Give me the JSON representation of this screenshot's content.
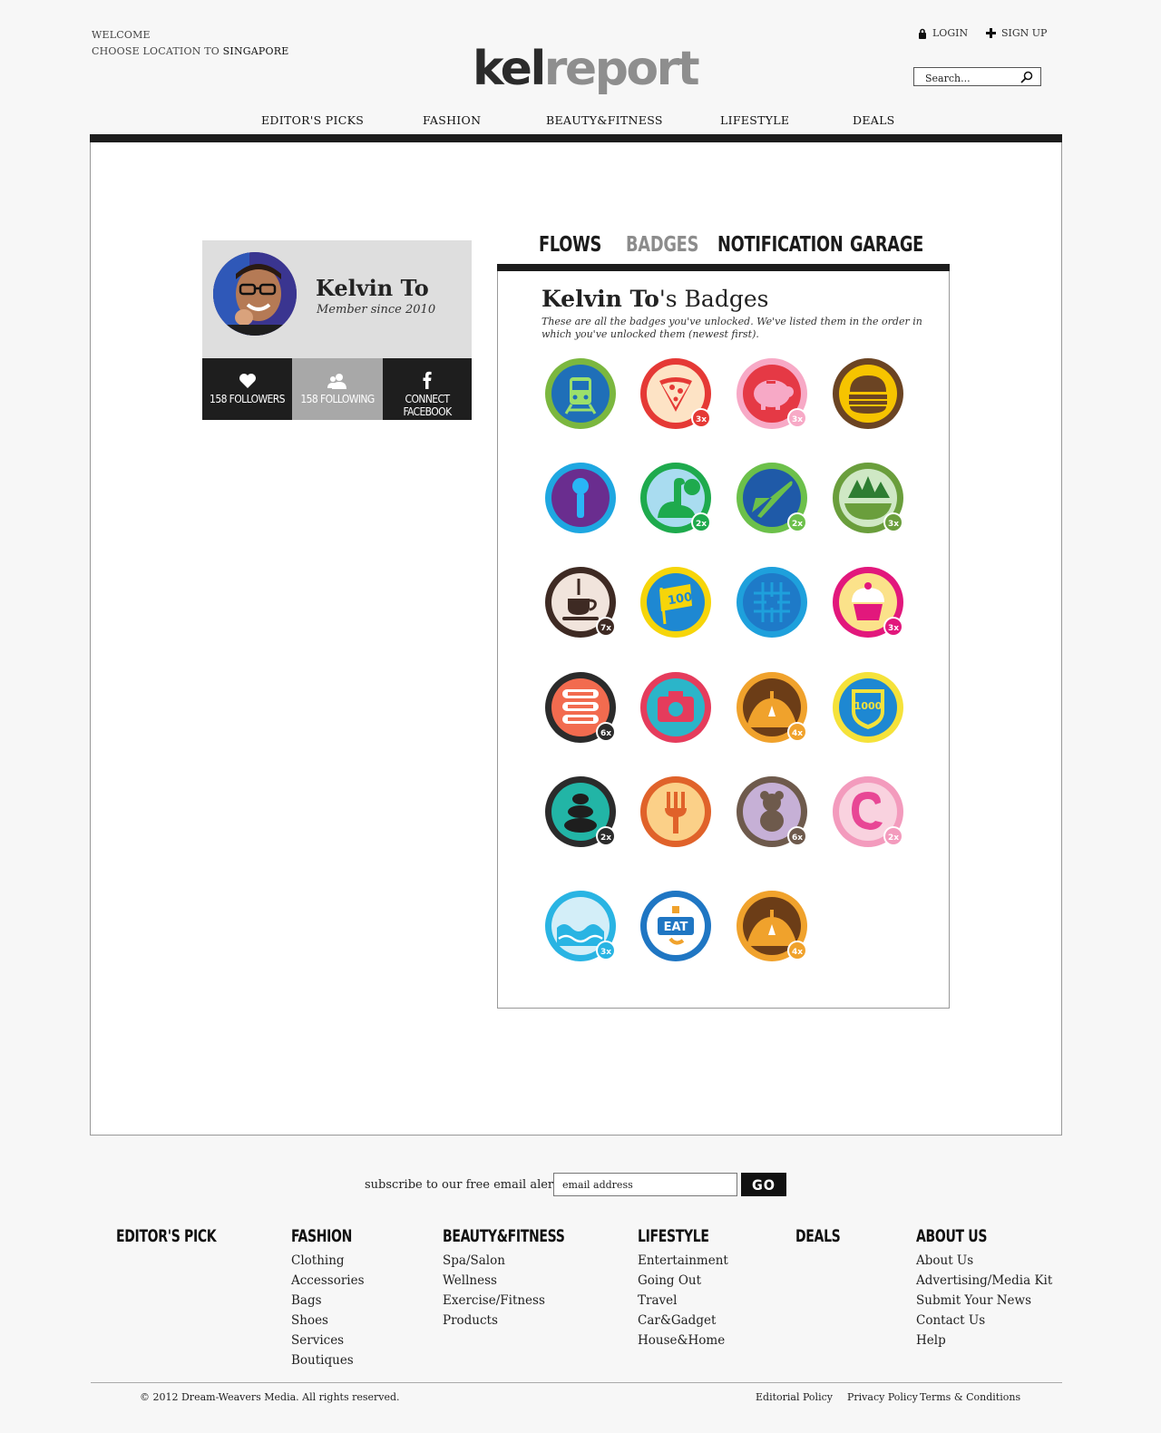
{
  "header": {
    "welcome": "WELCOME",
    "location_prefix": "CHOOSE LOCATION TO ",
    "location": "SINGAPORE",
    "logo_kel": "kel",
    "logo_report": "report",
    "login": "LOGIN",
    "signup": "SIGN UP",
    "search_placeholder": "Search..."
  },
  "nav": [
    "EDITOR'S PICKS",
    "FASHION",
    "BEAUTY&FITNESS",
    "LIFESTYLE",
    "DEALS"
  ],
  "profile": {
    "name": "Kelvin To",
    "since": "Member since 2010",
    "followers": "158 FOLLOWERS",
    "following": "158 FOLLOWING",
    "facebook": "CONNECT FACEBOOK"
  },
  "tabs": [
    "FLOWS",
    "BADGES",
    "NOTIFICATION",
    "GARAGE"
  ],
  "active_tab": "BADGES",
  "badges_panel": {
    "title_name": "Kelvin To",
    "title_suffix": "'s Badges",
    "description": "These are all the badges you've unlocked. We've listed them in the order in which you've unlocked them (newest first)."
  },
  "badges": [
    {
      "icon": "train-icon",
      "ring": "#7bb73f",
      "fill": "#1f6fb8",
      "count": ""
    },
    {
      "icon": "pizza-icon",
      "ring": "#e53935",
      "fill": "#fde3c5",
      "count": "3x"
    },
    {
      "icon": "piggy-bank-icon",
      "ring": "#f7a9c6",
      "fill": "#e53945",
      "count": "3x"
    },
    {
      "icon": "burger-icon",
      "ring": "#6b4423",
      "fill": "#f6c400",
      "count": ""
    },
    {
      "icon": "microphone-icon",
      "ring": "#1ea7e1",
      "fill": "#6a2d8f",
      "count": ""
    },
    {
      "icon": "dinosaur-icon",
      "ring": "#1eaa4d",
      "fill": "#a9dcf0",
      "count": "2x"
    },
    {
      "icon": "airplane-icon",
      "ring": "#6cc04a",
      "fill": "#1f5aa8",
      "count": "2x"
    },
    {
      "icon": "trees-icon",
      "ring": "#6a9e3c",
      "fill": "#cfe8c5",
      "count": "3x"
    },
    {
      "icon": "coffee-icon",
      "ring": "#3e2a23",
      "fill": "#f1e4dc",
      "count": "7x"
    },
    {
      "icon": "flag-100-icon",
      "ring": "#f6d50a",
      "fill": "#1e88d2",
      "count": ""
    },
    {
      "icon": "grid-pattern-icon",
      "ring": "#1ea0dc",
      "fill": "#1e7ac8",
      "count": ""
    },
    {
      "icon": "cupcake-icon",
      "ring": "#e2187c",
      "fill": "#fbe28a",
      "count": "3x"
    },
    {
      "icon": "sushi-icon",
      "ring": "#2b2b2b",
      "fill": "#f26b4f",
      "count": "6x"
    },
    {
      "icon": "camera-icon",
      "ring": "#e53c5c",
      "fill": "#2bb5c9",
      "count": ""
    },
    {
      "icon": "hill-icon",
      "ring": "#f0a22c",
      "fill": "#6c3d17",
      "count": "4x"
    },
    {
      "icon": "shield-1000-icon",
      "ring": "#f5e23a",
      "fill": "#1e88d2",
      "count": ""
    },
    {
      "icon": "stones-icon",
      "ring": "#2b2b2b",
      "fill": "#22b5a6",
      "count": "2x"
    },
    {
      "icon": "fork-icon",
      "ring": "#e0622a",
      "fill": "#fbd088",
      "count": ""
    },
    {
      "icon": "bear-icon",
      "ring": "#6e5a4c",
      "fill": "#c6b0d6",
      "count": "6x"
    },
    {
      "icon": "shrimp-icon",
      "ring": "#f39bbd",
      "fill": "#f9d2df",
      "count": "2x"
    },
    {
      "icon": "wave-icon",
      "ring": "#29b4e3",
      "fill": "#d3eef8",
      "count": "3x"
    },
    {
      "icon": "eat-sign-icon",
      "ring": "#1f76c3",
      "fill": "#ffffff",
      "count": ""
    },
    {
      "icon": "hill-icon",
      "ring": "#f0a22c",
      "fill": "#6c3d17",
      "count": "4x"
    }
  ],
  "footer": {
    "subscribe_label": "subscribe to our free email alerts",
    "email_placeholder": "email address",
    "go": "GO",
    "columns": [
      {
        "title": "EDITOR'S PICK",
        "links": []
      },
      {
        "title": "FASHION",
        "links": [
          "Clothing",
          "Accessories",
          "Bags",
          "Shoes",
          "Services",
          "Boutiques"
        ]
      },
      {
        "title": "BEAUTY&FITNESS",
        "links": [
          "Spa/Salon",
          "Wellness",
          "Exercise/Fitness",
          "Products"
        ]
      },
      {
        "title": "LIFESTYLE",
        "links": [
          "Entertainment",
          "Going Out",
          "Travel",
          "Car&Gadget",
          "House&Home"
        ]
      },
      {
        "title": "DEALS",
        "links": []
      },
      {
        "title": "ABOUT US",
        "links": [
          "About Us",
          "Advertising/Media Kit",
          "Submit Your News",
          "Contact Us",
          "Help"
        ]
      }
    ],
    "copyright": "© 2012 Dream-Weavers Media. All rights reserved.",
    "legal": [
      "Editorial Policy",
      "Privacy Policy",
      "Terms & Conditions"
    ]
  }
}
